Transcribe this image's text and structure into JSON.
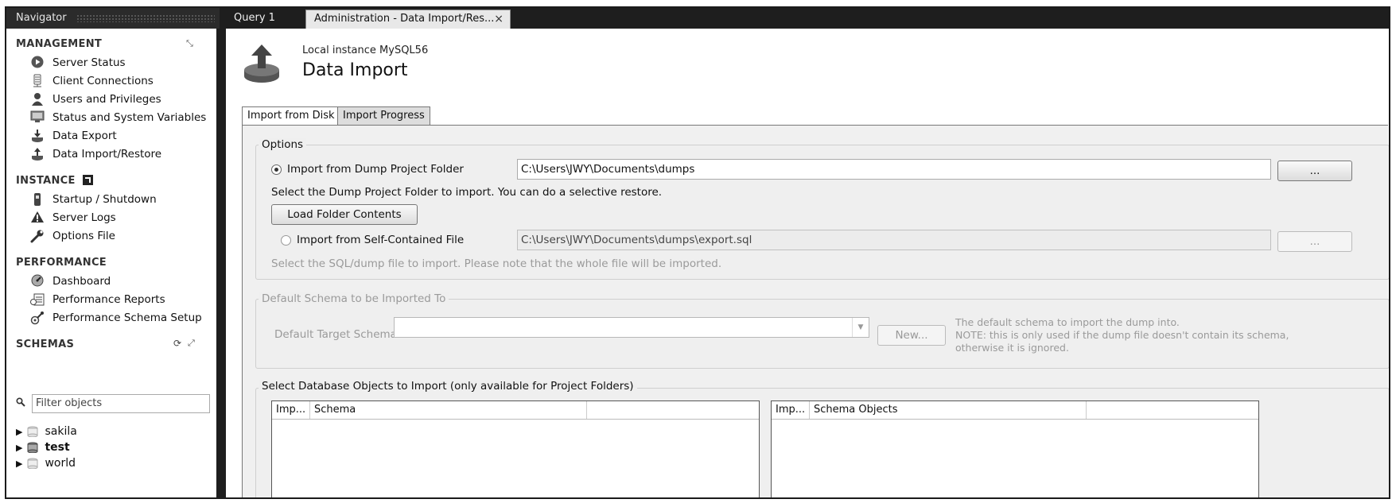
{
  "window": {
    "navigator_title": "Navigator",
    "tabs": [
      {
        "label": "Query 1"
      },
      {
        "label": "Administration - Data Import/Res...",
        "close": "×"
      }
    ]
  },
  "sidebar": {
    "management": {
      "title": "MANAGEMENT",
      "items": [
        {
          "label": "Server Status",
          "icon": "play-circle-icon"
        },
        {
          "label": "Client Connections",
          "icon": "client-connections-icon"
        },
        {
          "label": "Users and Privileges",
          "icon": "user-icon"
        },
        {
          "label": "Status and System Variables",
          "icon": "monitor-icon"
        },
        {
          "label": "Data Export",
          "icon": "export-icon"
        },
        {
          "label": "Data Import/Restore",
          "icon": "import-icon"
        }
      ]
    },
    "instance": {
      "title": "INSTANCE",
      "items": [
        {
          "label": "Startup / Shutdown",
          "icon": "startup-icon"
        },
        {
          "label": "Server Logs",
          "icon": "warning-icon"
        },
        {
          "label": "Options File",
          "icon": "wrench-icon"
        }
      ]
    },
    "performance": {
      "title": "PERFORMANCE",
      "items": [
        {
          "label": "Dashboard",
          "icon": "dashboard-icon"
        },
        {
          "label": "Performance Reports",
          "icon": "reports-icon"
        },
        {
          "label": "Performance Schema Setup",
          "icon": "schema-setup-icon"
        }
      ]
    },
    "schemas": {
      "title": "SCHEMAS",
      "filter_placeholder": "Filter objects",
      "items": [
        {
          "label": "sakila",
          "bold": false
        },
        {
          "label": "test",
          "bold": true
        },
        {
          "label": "world",
          "bold": false
        }
      ]
    }
  },
  "main": {
    "instance_name": "Local instance MySQL56",
    "title": "Data Import",
    "tabs": [
      {
        "label": "Import from Disk",
        "active": true
      },
      {
        "label": "Import Progress",
        "active": false
      }
    ],
    "options": {
      "title": "Options",
      "dump_folder_label": "Import from Dump Project Folder",
      "dump_folder_value": "C:\\Users\\JWY\\Documents\\dumps",
      "browse_label": "...",
      "dump_folder_hint": "Select the Dump Project Folder to import. You can do a selective restore.",
      "load_button": "Load Folder Contents",
      "self_contained_label": "Import from Self-Contained File",
      "self_contained_value": "C:\\Users\\JWY\\Documents\\dumps\\export.sql",
      "self_contained_hint": "Select the SQL/dump file to import. Please note that the whole file will be imported."
    },
    "default_schema": {
      "title": "Default Schema to be Imported To",
      "target_label": "Default Target Schema:",
      "target_value": "",
      "new_button": "New...",
      "note_line1": "The default schema to import the dump into.",
      "note_line2": "NOTE: this is only used if the dump file doesn't contain its schema,",
      "note_line3": "otherwise it is ignored."
    },
    "objects": {
      "title": "Select Database Objects to Import (only available for Project Folders)",
      "left_columns": [
        "Imp...",
        "Schema"
      ],
      "right_columns": [
        "Imp...",
        "Schema Objects"
      ]
    }
  }
}
